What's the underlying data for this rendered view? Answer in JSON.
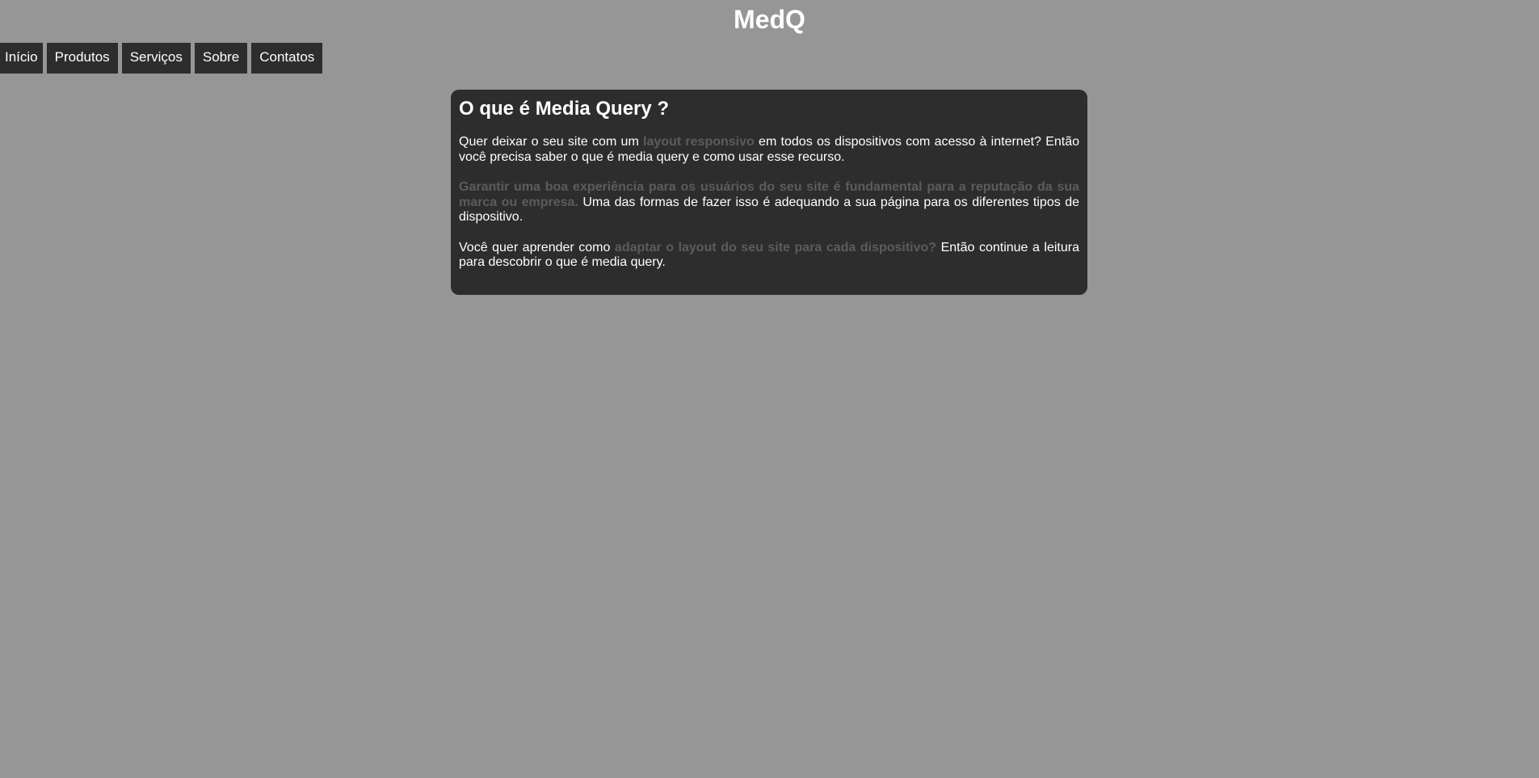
{
  "header": {
    "title": "MedQ"
  },
  "nav": {
    "items": [
      {
        "label": "Início"
      },
      {
        "label": "Produtos"
      },
      {
        "label": "Serviços"
      },
      {
        "label": "Sobre"
      },
      {
        "label": "Contatos"
      }
    ]
  },
  "article": {
    "heading": "O que é Media Query ?",
    "p1": {
      "before": "Quer deixar o seu site com um ",
      "highlight": "layout responsivo",
      "after": " em todos os dispositivos com acesso à internet? Então você precisa saber o que é media query e como usar esse recurso."
    },
    "p2": {
      "highlight": "Garantir uma boa experiência para os usuários do seu site é fundamental para a reputação da sua marca ou empresa.",
      "after": " Uma das formas de fazer isso é adequando a sua página para os diferentes tipos de dispositivo."
    },
    "p3": {
      "before": "Você quer aprender como ",
      "highlight": "adaptar o layout do seu site para cada dispositivo?",
      "after": " Então continue a leitura para descobrir o que é media query."
    }
  },
  "colors": {
    "background": "#969696",
    "panel": "#2d2d2d",
    "text": "#ffffff",
    "highlight": "#5c5c5c"
  }
}
